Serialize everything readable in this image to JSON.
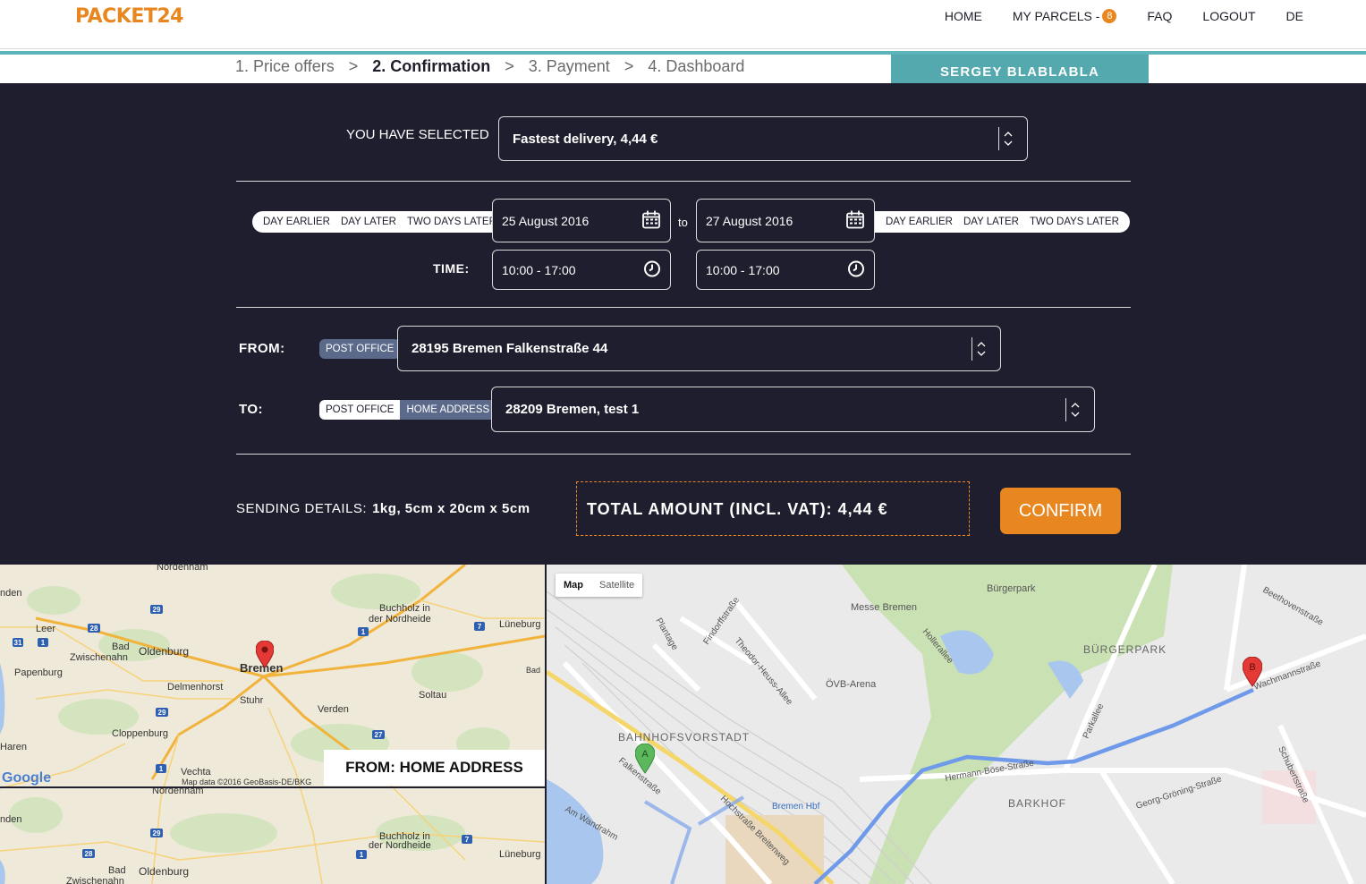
{
  "brand": {
    "logo": "PACKET24",
    "accent": "#e8861f",
    "teal": "#53a9ae",
    "panel_bg": "#1e1e2e"
  },
  "nav": {
    "home": "HOME",
    "parcels": "MY PARCELS -",
    "parcels_count": "8",
    "faq": "FAQ",
    "logout": "LOGOUT",
    "lang": "DE"
  },
  "steps": {
    "s1": "1. Price offers",
    "s2": "2. Confirmation",
    "s3": "3. Payment",
    "s4": "4. Dashboard",
    "sep": ">"
  },
  "user": {
    "name": "SERGEY BLABLABLA"
  },
  "selection": {
    "label": "YOU HAVE SELECTED",
    "value": "Fastest delivery, 4,44 €"
  },
  "dates": {
    "left_pills": [
      "DAY EARLIER",
      "DAY LATER",
      "TWO DAYS LATER"
    ],
    "from_date": "25 August 2016",
    "to_text": "to",
    "to_date": "27 August 2016",
    "right_pills": [
      "DAY EARLIER",
      "DAY LATER",
      "TWO DAYS LATER"
    ],
    "time_label": "TIME:",
    "from_time": "10:00 - 17:00",
    "to_time": "10:00 - 17:00"
  },
  "route": {
    "from_label": "FROM:",
    "from_option": "POST OFFICE",
    "from_address": "28195 Bremen Falkenstraße 44",
    "to_label": "TO:",
    "to_option_post": "POST OFFICE",
    "to_option_home": "HOME ADDRESS",
    "to_address": "28209 Bremen, test 1"
  },
  "summary": {
    "sending_label": "SENDING DETAILS:",
    "sending_value": "1kg, 5cm x 20cm x 5cm",
    "total": "TOTAL AMOUNT (INCL. VAT): 4,44 €",
    "confirm": "CONFIRM"
  },
  "map_left": {
    "caption": "FROM: HOME ADDRESS",
    "attribution": "Map data ©2016 GeoBasis-DE/BKG",
    "google": "Google",
    "places": [
      "Bremen",
      "Oldenburg",
      "Delmenhorst",
      "Cloppenburg",
      "Verden",
      "Soltau",
      "Stuhr",
      "Vechta",
      "Papenburg",
      "Leer",
      "Zwischenahn",
      "Buchholz in der Nordheide",
      "Lüneburg",
      "Bad"
    ]
  },
  "map_right": {
    "toggle_map": "Map",
    "toggle_satellite": "Satellite",
    "places": [
      "Bürgerpark",
      "BÜRGERPARK",
      "Messe Bremen",
      "ÖVB-Arena",
      "BAHNHOFSVORSTADT",
      "BARKHOF",
      "Bremen Hbf",
      "Hermann-Böse-Straße",
      "Wachmannstraße",
      "Beethovenstraße",
      "Georg-Gröning-Straße",
      "Hochstraße Breitenweg",
      "Falkenstraße",
      "Am Wandrahm",
      "Plantage",
      "Findorffstraße",
      "Theodor-Heuss-Allee",
      "Hollerallee",
      "Parkallee",
      "Schubertstraße"
    ],
    "marker_a": "A",
    "marker_b": "B"
  }
}
